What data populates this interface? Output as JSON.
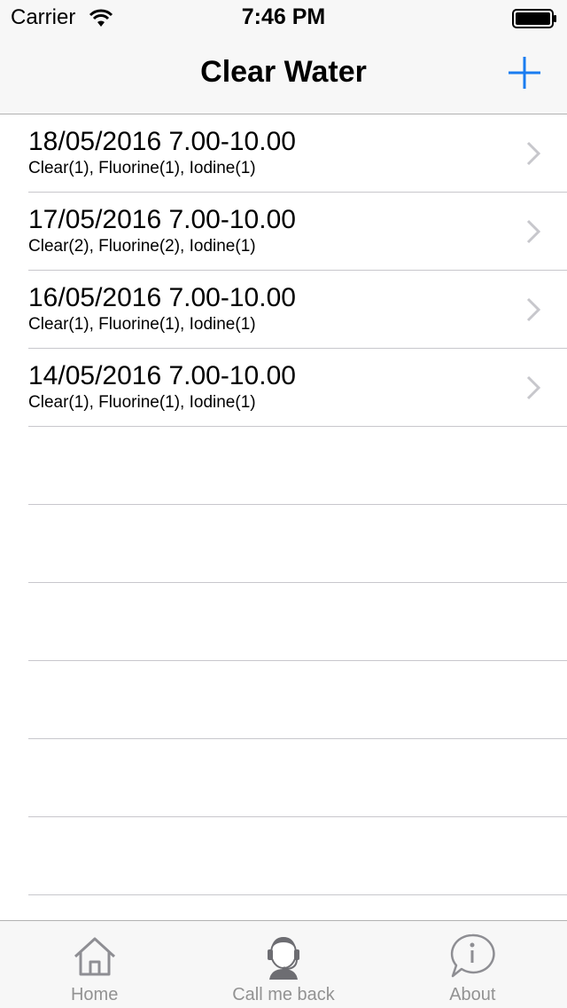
{
  "status_bar": {
    "carrier": "Carrier",
    "time": "7:46 PM"
  },
  "nav": {
    "title": "Clear Water",
    "add_icon": "plus-icon",
    "accent_color": "#1a7cf0"
  },
  "rows": [
    {
      "title": "18/05/2016 7.00-10.00",
      "subtitle": "Clear(1), Fluorine(1), Iodine(1)"
    },
    {
      "title": "17/05/2016 7.00-10.00",
      "subtitle": "Clear(2), Fluorine(2), Iodine(1)"
    },
    {
      "title": "16/05/2016 7.00-10.00",
      "subtitle": "Clear(1), Fluorine(1), Iodine(1)"
    },
    {
      "title": "14/05/2016 7.00-10.00",
      "subtitle": "Clear(1), Fluorine(1), Iodine(1)"
    }
  ],
  "tabs": [
    {
      "label": "Home",
      "icon": "home-icon"
    },
    {
      "label": "Call me back",
      "icon": "headset-person-icon"
    },
    {
      "label": "About",
      "icon": "info-bubble-icon"
    }
  ]
}
